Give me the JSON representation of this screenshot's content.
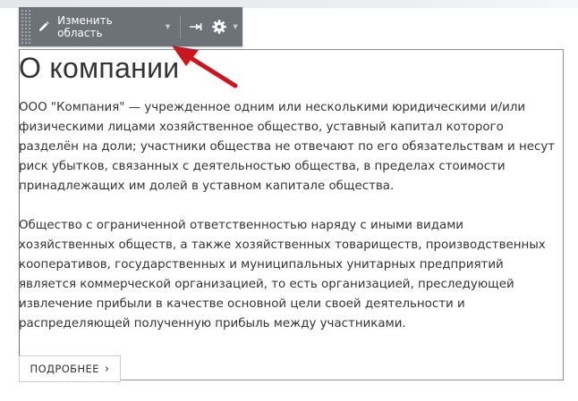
{
  "toolbar": {
    "edit_label": "Изменить область",
    "edit_icon": "pencil-icon",
    "pin_icon": "pin-icon",
    "settings_icon": "gear-icon"
  },
  "content": {
    "title": "О компании",
    "paragraphs": [
      "ООО \"Компания\" — учрежденное одним или несколькими юридическими и/или физическими лицами хозяйственное общество, уставный капитал которого разделён на доли; участники общества не отвечают по его обязательствам и несут риск убытков, связанных с деятельностью общества, в пределах стоимости принадлежащих им долей в уставном капитале общества.",
      "Общество с ограниченной ответственностью наряду с иными видами хозяйственных обществ, а также хозяйственных товариществ, производственных кооперативов, государственных и муниципальных унитарных предприятий является коммерческой организацией, то есть организацией, преследующей извлечение прибыли в качестве основной цели своей деятельности и распределяющей полученную прибыль между участниками."
    ],
    "more_label": "ПОДРОБНЕЕ",
    "more_chevron": "›"
  },
  "colors": {
    "toolbar_bg": "#6d7178",
    "annotation_arrow": "#c8171e",
    "text": "#333333"
  }
}
